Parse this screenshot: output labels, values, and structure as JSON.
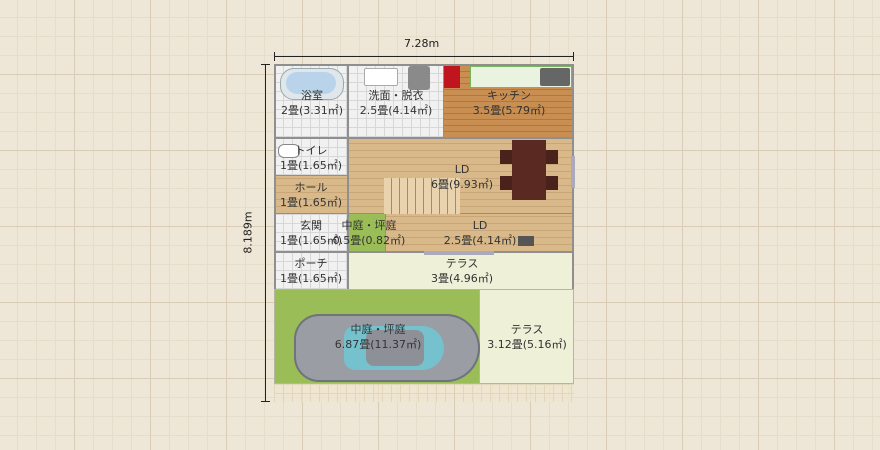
{
  "dimensions": {
    "width": "7.28m",
    "height": "8.189m"
  },
  "rooms": [
    {
      "id": "bath",
      "name": "浴室",
      "size": "2畳(3.31㎡)"
    },
    {
      "id": "wash",
      "name": "洗面・脱衣",
      "size": "2.5畳(4.14㎡)"
    },
    {
      "id": "kitchen",
      "name": "キッチン",
      "size": "3.5畳(5.79㎡)"
    },
    {
      "id": "toilet",
      "name": "トイレ",
      "size": "1畳(1.65㎡)"
    },
    {
      "id": "ld_upper",
      "name": "LD",
      "size": "6畳(9.93㎡)"
    },
    {
      "id": "hall",
      "name": "ホール",
      "size": "1畳(1.65㎡)"
    },
    {
      "id": "entrance",
      "name": "玄関",
      "size": "1畳(1.65㎡)"
    },
    {
      "id": "courtyard_small",
      "name": "中庭・坪庭",
      "size": "0.5畳(0.82㎡)"
    },
    {
      "id": "ld_lower",
      "name": "LD",
      "size": "2.5畳(4.14㎡)"
    },
    {
      "id": "porch",
      "name": "ポーチ",
      "size": "1畳(1.65㎡)"
    },
    {
      "id": "terrace_mid",
      "name": "テラス",
      "size": "3畳(4.96㎡)"
    },
    {
      "id": "courtyard_large",
      "name": "中庭・坪庭",
      "size": "6.87畳(11.37㎡)"
    },
    {
      "id": "terrace_right",
      "name": "テラス",
      "size": "3.12畳(5.16㎡)"
    }
  ],
  "colors": {
    "wall": "#8f8f8f",
    "lawn": "#9bbd58",
    "wood": "#d9b98a",
    "kitchen_floor": "#c98f52",
    "terrace": "#eef0d8"
  }
}
